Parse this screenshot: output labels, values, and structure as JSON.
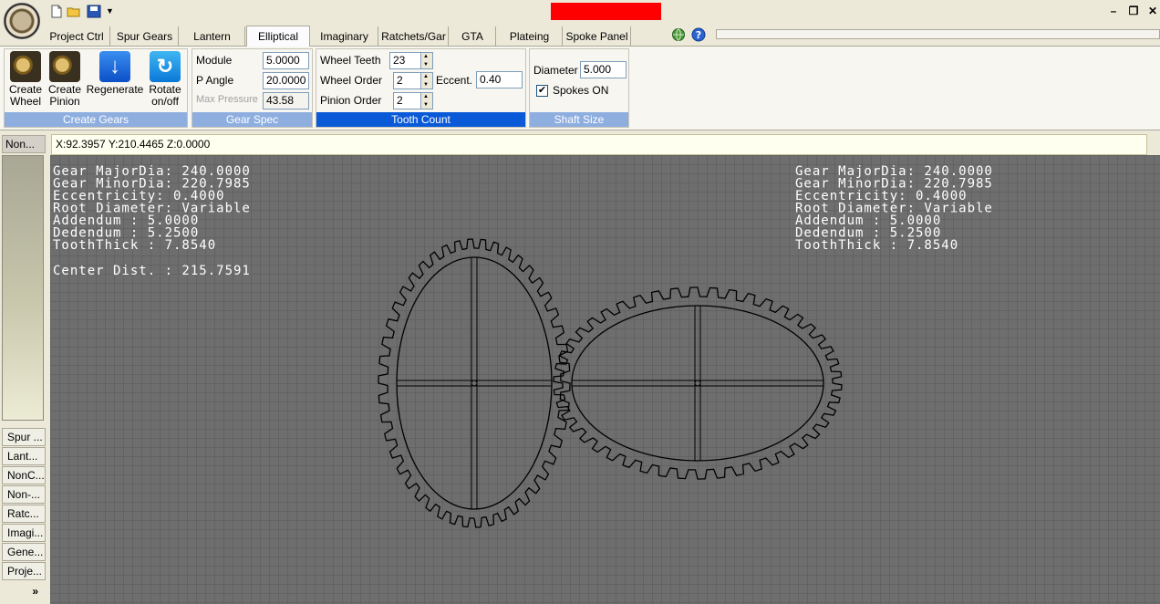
{
  "tabs": [
    {
      "label": "Project Ctrl",
      "active": false
    },
    {
      "label": "Spur Gears",
      "active": false
    },
    {
      "label": "Lantern",
      "active": false
    },
    {
      "label": "Elliptical",
      "active": true
    },
    {
      "label": "Imaginary",
      "active": false
    },
    {
      "label": "Ratchets/Gar",
      "active": false
    },
    {
      "label": "GTA",
      "active": false
    },
    {
      "label": "Plateing",
      "active": false
    },
    {
      "label": "Spoke Panel",
      "active": false
    }
  ],
  "ribbon": {
    "create_gears": {
      "caption": "Create Gears",
      "buttons": [
        {
          "label": "Create\nWheel",
          "icon": "gear-icon"
        },
        {
          "label": "Create\nPinion",
          "icon": "gear-icon"
        },
        {
          "label": "Regenerate",
          "icon": "arrow-down-icon"
        },
        {
          "label": "Rotate\non/off",
          "icon": "rotate-icon"
        }
      ]
    },
    "gear_spec": {
      "caption": "Gear Spec",
      "module_label": "Module",
      "module_value": "5.0000",
      "pangle_label": "P Angle",
      "pangle_value": "20.0000",
      "maxpressure_label": "Max Pressure",
      "maxpressure_value": "43.58"
    },
    "tooth_count": {
      "caption": "Tooth Count",
      "wheel_teeth_label": "Wheel Teeth",
      "wheel_teeth_value": "23",
      "wheel_order_label": "Wheel Order",
      "wheel_order_value": "2",
      "pinion_order_label": "Pinion Order",
      "pinion_order_value": "2",
      "eccent_label": "Eccent.",
      "eccent_value": "0.40"
    },
    "shaft_size": {
      "caption": "Shaft Size",
      "diameter_label": "Diameter",
      "diameter_value": "5.000",
      "spokes_label": "Spokes ON",
      "spokes_checked": true
    }
  },
  "coords": "X:92.3957 Y:210.4465 Z:0.0000",
  "side": {
    "top_tab": "Non...",
    "tabs": [
      "Spur ...",
      "Lant...",
      "NonC...",
      "Non-...",
      "Ratc...",
      "Imagi...",
      "Gene...",
      "Proje..."
    ],
    "more": "»"
  },
  "info_left": [
    "Gear  MajorDia:      240.0000",
    "Gear  MinorDia:       220.7985",
    "Eccentricity:       0.4000",
    "Root  Diameter:    Variable",
    "Addendum      :     5.0000",
    "Dedendum      :     5.2500",
    "ToothThick    :     7.8540"
  ],
  "center_dist": "Center  Dist.   :    215.7591",
  "info_right": [
    "Gear  MajorDia:      240.0000",
    "Gear  MinorDia:       220.7985",
    "Eccentricity:       0.4000",
    "Root  Diameter:    Variable",
    "Addendum      :     5.0000",
    "Dedendum      :     5.2500",
    "ToothThick    :     7.8540"
  ],
  "colors": {
    "canvas_bg": "#6e6e6e",
    "grid": "#5a5a5a",
    "gear_stroke": "#000000",
    "accent_caption": "#0a5ad8"
  }
}
